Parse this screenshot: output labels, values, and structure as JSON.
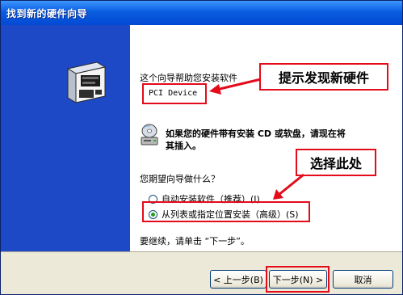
{
  "window": {
    "title": "找到新的硬件向导"
  },
  "content": {
    "intro": "这个向导帮助您安装软件",
    "device_name": "PCI Device",
    "cd_hint_line1": "如果您的硬件带有安装 CD 或软盘，请现在将",
    "cd_hint_line2": "其插入。",
    "question": "您期望向导做什么？",
    "options": [
      {
        "label": "自动安装软件（推荐）(I)",
        "checked": false
      },
      {
        "label": "从列表或指定位置安装（高级）(S)",
        "checked": true
      }
    ],
    "continue_text": "要继续，请单击 “下一步”。"
  },
  "annotations": {
    "callout_top": "提示发现新硬件",
    "callout_bottom": "选择此处",
    "color": "#e40b1a"
  },
  "buttons": {
    "back": "< 上一步(B)",
    "next": "下一步(N) >",
    "cancel": "取消"
  },
  "icons": [
    "hardware-icon",
    "cd-drive-icon"
  ]
}
